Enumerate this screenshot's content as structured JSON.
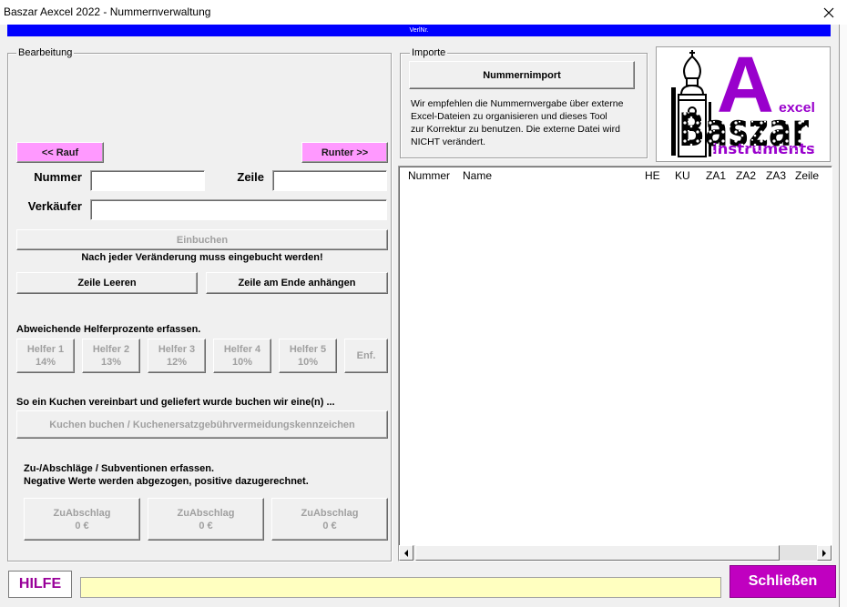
{
  "window": {
    "title": "Baszar Aexcel 2022 - Nummernverwaltung"
  },
  "progress": {
    "label": "VerlNr."
  },
  "bearbeitung": {
    "legend": "Bearbeitung",
    "rauf_label": "<< Rauf",
    "runter_label": "Runter >>",
    "nummer": {
      "label": "Nummer",
      "value": ""
    },
    "zeile": {
      "label": "Zeile",
      "value": ""
    },
    "verkaeufer": {
      "label": "Verkäufer",
      "value": ""
    },
    "einbuchen_label": "Einbuchen",
    "einbuchen_hint": "Nach jeder Veränderung muss eingebucht werden!",
    "zeile_leeren_label": "Zeile Leeren",
    "zeile_anhaengen_label": "Zeile am Ende anhängen",
    "helfer_heading": "Abweichende Helferprozente erfassen.",
    "helfer": [
      {
        "name": "Helfer 1",
        "percent": "14%"
      },
      {
        "name": "Helfer 2",
        "percent": "13%"
      },
      {
        "name": "Helfer 3",
        "percent": "12%"
      },
      {
        "name": "Helfer 4",
        "percent": "10%"
      },
      {
        "name": "Helfer 5",
        "percent": "10%"
      }
    ],
    "entf_label": "Enf.",
    "kuchen_heading": "So ein Kuchen vereinbart und geliefert wurde buchen wir eine(n) ...",
    "kuchen_button_label": "Kuchen buchen / Kuchenersatzgebührvermeidungskennzeichen",
    "zuabschlag_heading": "Zu-/Abschläge / Subventionen erfassen.",
    "zuabschlag_subheading": "Negative Werte werden abgezogen, positive dazugerechnet.",
    "zuabschlag": [
      {
        "label": "ZuAbschlag",
        "value": "0 €"
      },
      {
        "label": "ZuAbschlag",
        "value": "0 €"
      },
      {
        "label": "ZuAbschlag",
        "value": "0 €"
      }
    ]
  },
  "importe": {
    "legend": "Importe",
    "button_label": "Nummernimport",
    "hint_lines": [
      "Wir empfehlen die Nummernvergabe über externe",
      "Excel-Dateien zu organisieren und dieses Tool",
      "zur Korrektur zu benutzen. Die externe Datei wird",
      "NICHT verändert."
    ]
  },
  "logo": {
    "letter": "A",
    "suffix": "excel",
    "name": "Baszar",
    "tagline": "instruments"
  },
  "list": {
    "columns": [
      "Nummer",
      "Name",
      "HE",
      "KU",
      "ZA1",
      "ZA2",
      "ZA3",
      "Zeile"
    ],
    "rows": []
  },
  "footer": {
    "hilfe_label": "HILFE",
    "status_text": "",
    "schliessen_label": "Schließen"
  },
  "icons": {
    "close": "close-icon",
    "scroll_left": "scroll-left-icon",
    "scroll_right": "scroll-right-icon",
    "logo_tower": "church-tower-icon"
  },
  "colors": {
    "progress_bar": "#0000FF",
    "nav_button": "#FF99FF",
    "close_button": "#C000C0",
    "help_text": "#990099",
    "status_bar": "#FFFFC0",
    "logo_purple": "#9900CC"
  }
}
